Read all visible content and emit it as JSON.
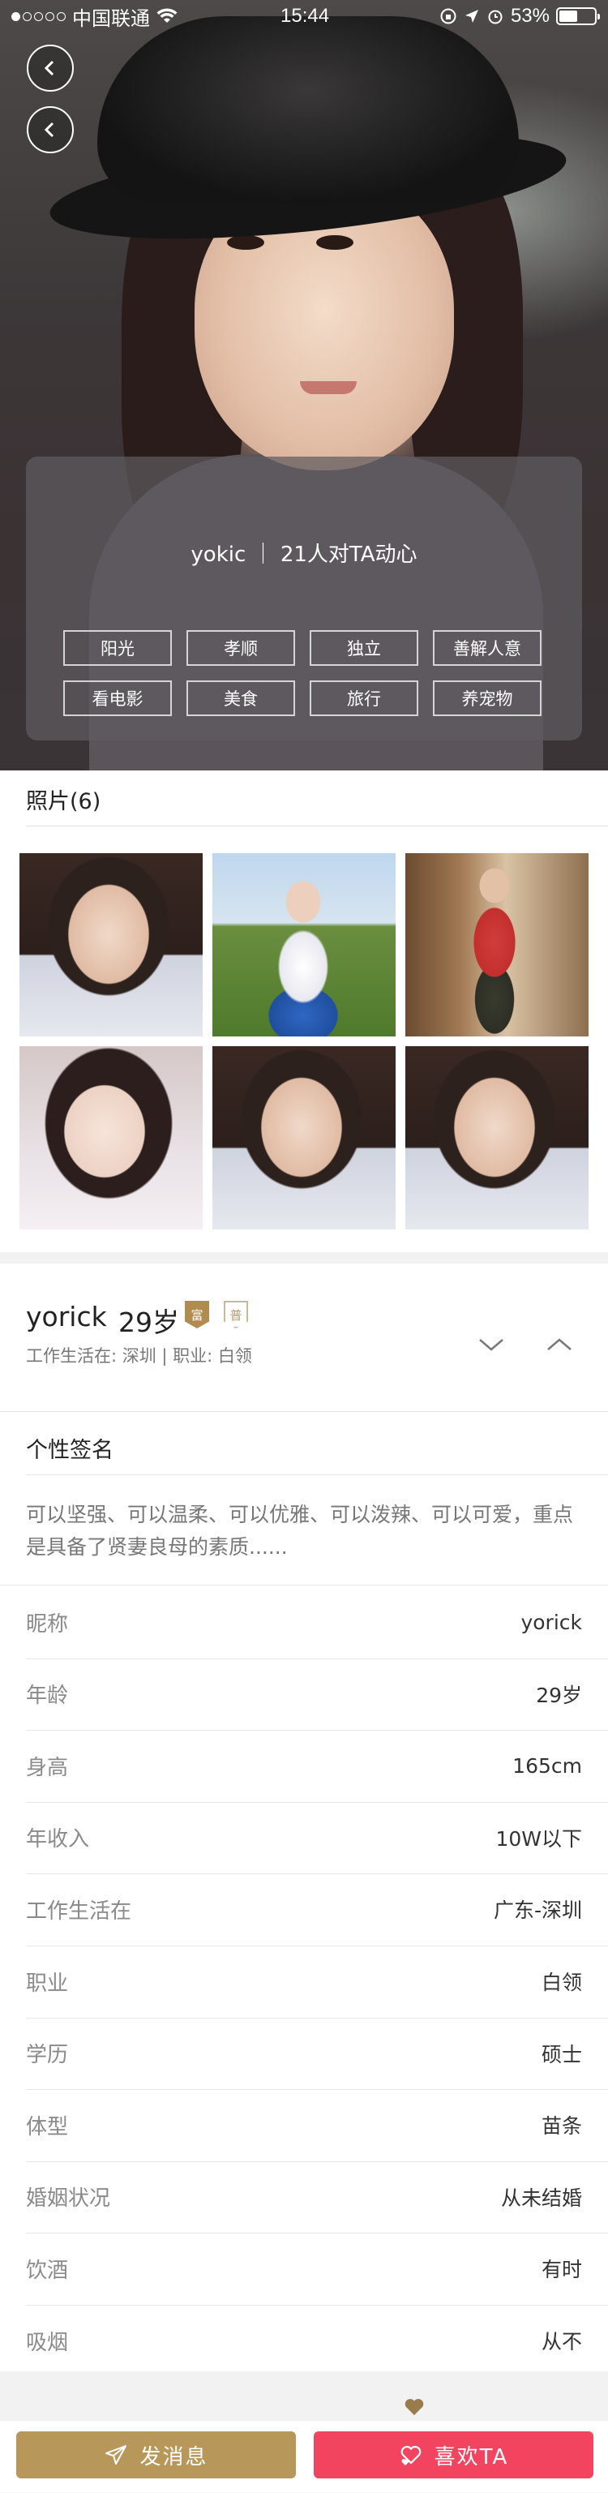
{
  "status_bar": {
    "carrier": "中国联通",
    "time": "15:44",
    "battery_percent": "53%",
    "battery_level": 0.53
  },
  "hero": {
    "headline": "yokic ｜ 21人对TA动心",
    "tags": [
      "阳光",
      "孝顺",
      "独立",
      "善解人意",
      "看电影",
      "美食",
      "旅行",
      "养宠物"
    ]
  },
  "photos": {
    "title": "照片(6)"
  },
  "profile": {
    "name": "yorick",
    "age": "29岁",
    "badge_rich": "富",
    "badge_house": "普",
    "subline": "工作生活在:  深圳  |  职业:  白领"
  },
  "signature": {
    "title": "个性签名",
    "text": "可以坚强、可以温柔、可以优雅、可以泼辣、可以可爱，重点是具备了贤妻良母的素质......"
  },
  "details": [
    {
      "key": "昵称",
      "value": "yorick"
    },
    {
      "key": "年龄",
      "value": "29岁"
    },
    {
      "key": "身高",
      "value": "165cm"
    },
    {
      "key": "年收入",
      "value": "10W以下"
    },
    {
      "key": "工作生活在",
      "value": "广东-深圳"
    },
    {
      "key": "职业",
      "value": "白领"
    },
    {
      "key": "学历",
      "value": "硕士"
    },
    {
      "key": "体型",
      "value": "苗条"
    },
    {
      "key": "婚姻状况",
      "value": "从未结婚"
    },
    {
      "key": "饮酒",
      "value": "有时"
    },
    {
      "key": "吸烟",
      "value": "从不"
    }
  ],
  "actions": {
    "message_label": "发消息",
    "like_label": "喜欢TA"
  },
  "colors": {
    "gold": "#b8975a",
    "like_red": "#f2445f"
  }
}
